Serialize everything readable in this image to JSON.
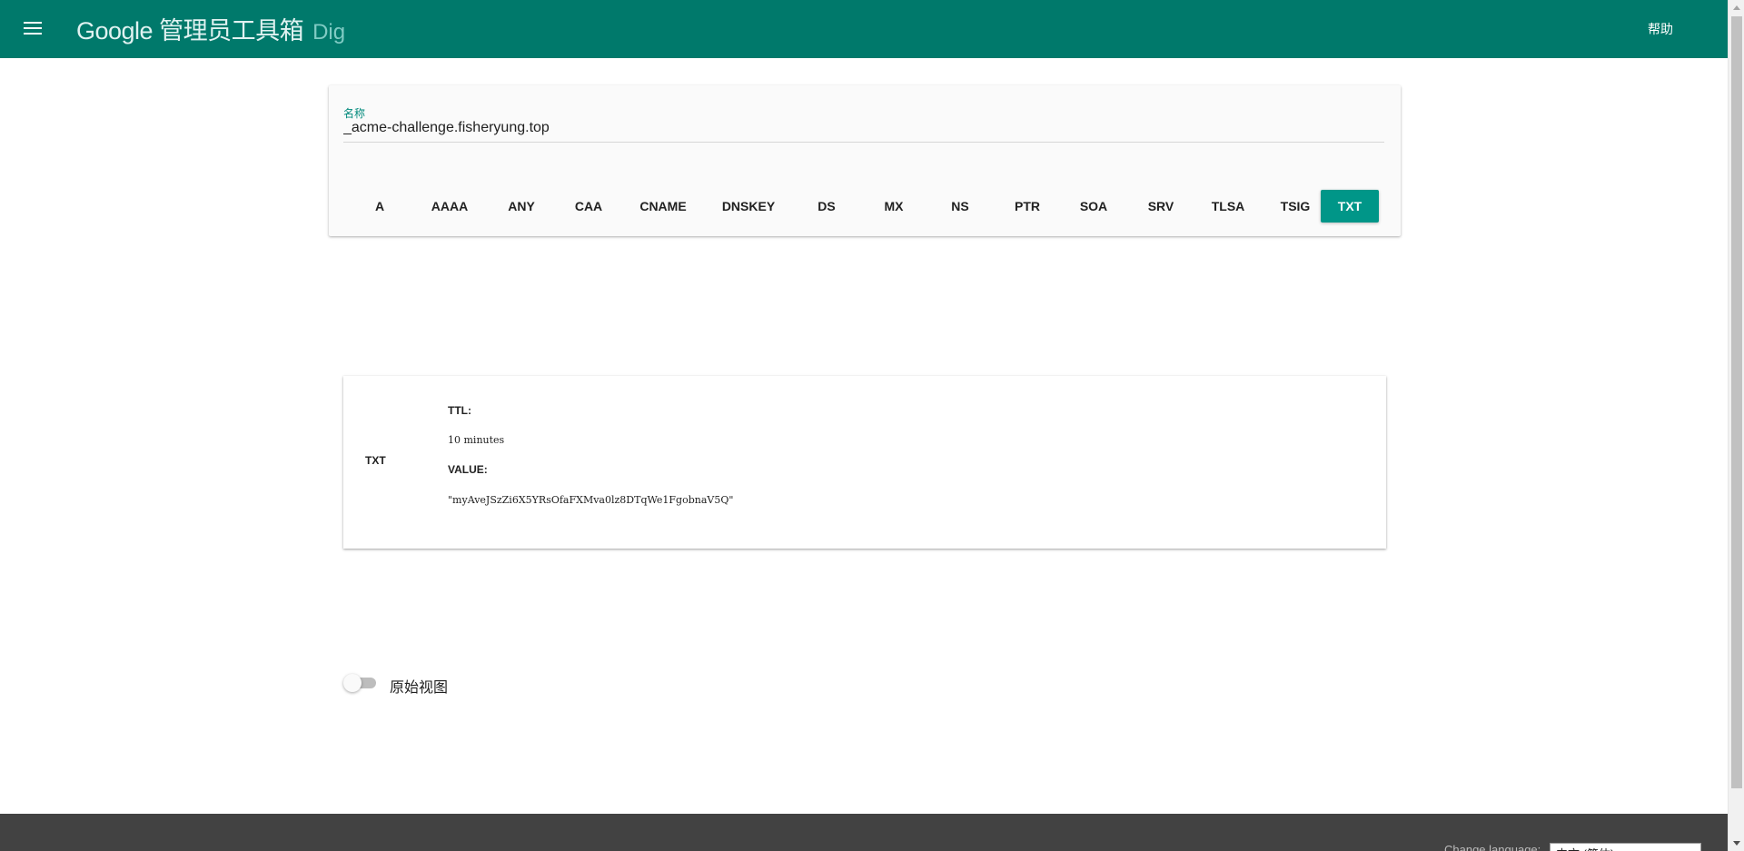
{
  "header": {
    "brand_main": "Google 管理员工具箱",
    "brand_tool": "Dig",
    "help_label": "帮助",
    "menu_icon": "hamburger-menu-icon",
    "color": "#00796b"
  },
  "search": {
    "name_label": "名称",
    "name_value": "_acme-challenge.fisheryung.top",
    "record_types": [
      "A",
      "AAAA",
      "ANY",
      "CAA",
      "CNAME",
      "DNSKEY",
      "DS",
      "MX",
      "NS",
      "PTR",
      "SOA",
      "SRV",
      "TLSA",
      "TSIG",
      "TXT"
    ],
    "selected_type": "TXT",
    "accent_color": "#009688"
  },
  "result": {
    "type": "TXT",
    "ttl_label": "TTL:",
    "ttl_value": "10 minutes",
    "value_label": "VALUE:",
    "value": "\"myAveJSzZi6X5YRsOfaFXMva0lz8DTqWe1FgobnaV5Q\""
  },
  "raw_view": {
    "label": "原始视图",
    "enabled": false
  },
  "footer": {
    "text": "Change language:",
    "language": "中文 (简体)"
  }
}
